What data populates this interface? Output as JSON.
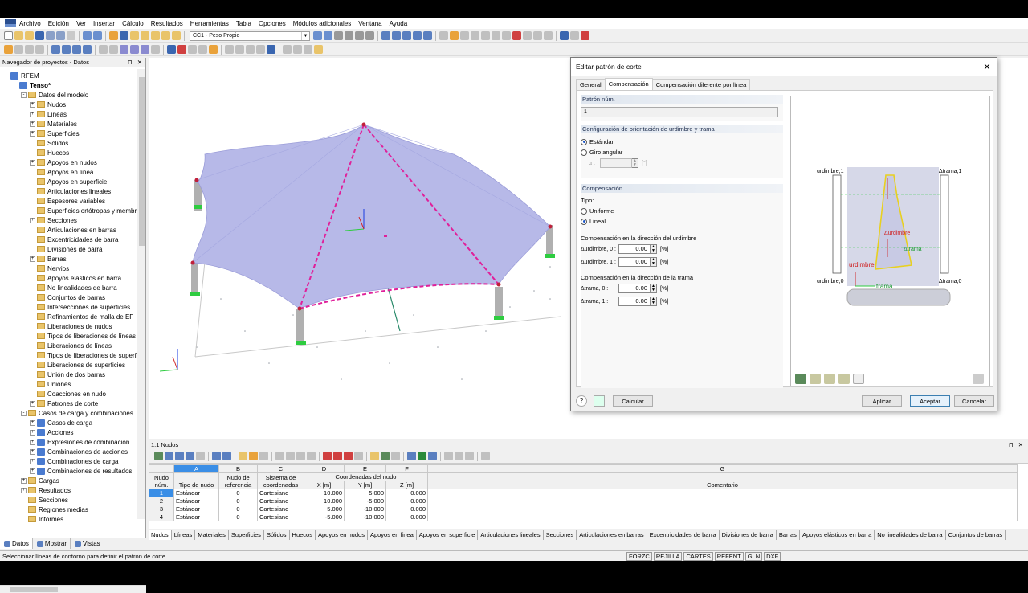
{
  "menu": [
    "Archivo",
    "Edición",
    "Ver",
    "Insertar",
    "Cálculo",
    "Resultados",
    "Herramientas",
    "Tabla",
    "Opciones",
    "Módulos adicionales",
    "Ventana",
    "Ayuda"
  ],
  "toolbar": {
    "loadcase": "CC1 - Peso Propio"
  },
  "navigator": {
    "title": "Navegador de proyectos - Datos",
    "items": [
      {
        "label": "RFEM",
        "level": 0,
        "kind": "root"
      },
      {
        "label": "Tenso*",
        "level": 1,
        "kind": "project"
      },
      {
        "label": "Datos del modelo",
        "level": 2,
        "kind": "folder",
        "exp": "-"
      },
      {
        "label": "Nudos",
        "level": 3,
        "kind": "folder",
        "exp": "+"
      },
      {
        "label": "Líneas",
        "level": 3,
        "kind": "folder",
        "exp": "+"
      },
      {
        "label": "Materiales",
        "level": 3,
        "kind": "folder",
        "exp": "+"
      },
      {
        "label": "Superficies",
        "level": 3,
        "kind": "folder",
        "exp": "+"
      },
      {
        "label": "Sólidos",
        "level": 3,
        "kind": "folder"
      },
      {
        "label": "Huecos",
        "level": 3,
        "kind": "folder"
      },
      {
        "label": "Apoyos en nudos",
        "level": 3,
        "kind": "folder",
        "exp": "+"
      },
      {
        "label": "Apoyos en línea",
        "level": 3,
        "kind": "folder"
      },
      {
        "label": "Apoyos en superficie",
        "level": 3,
        "kind": "folder"
      },
      {
        "label": "Articulaciones lineales",
        "level": 3,
        "kind": "folder"
      },
      {
        "label": "Espesores variables",
        "level": 3,
        "kind": "folder"
      },
      {
        "label": "Superficies ortótropas y membr",
        "level": 3,
        "kind": "folder"
      },
      {
        "label": "Secciones",
        "level": 3,
        "kind": "folder",
        "exp": "+"
      },
      {
        "label": "Articulaciones en barras",
        "level": 3,
        "kind": "folder"
      },
      {
        "label": "Excentricidades de barra",
        "level": 3,
        "kind": "folder"
      },
      {
        "label": "Divisiones de barra",
        "level": 3,
        "kind": "folder"
      },
      {
        "label": "Barras",
        "level": 3,
        "kind": "folder",
        "exp": "+"
      },
      {
        "label": "Nervios",
        "level": 3,
        "kind": "folder"
      },
      {
        "label": "Apoyos elásticos en barra",
        "level": 3,
        "kind": "folder"
      },
      {
        "label": "No linealidades de barra",
        "level": 3,
        "kind": "folder"
      },
      {
        "label": "Conjuntos de barras",
        "level": 3,
        "kind": "folder"
      },
      {
        "label": "Intersecciones de superficies",
        "level": 3,
        "kind": "folder"
      },
      {
        "label": "Refinamientos de malla de EF",
        "level": 3,
        "kind": "folder"
      },
      {
        "label": "Liberaciones de nudos",
        "level": 3,
        "kind": "folder"
      },
      {
        "label": "Tipos de liberaciones de líneas",
        "level": 3,
        "kind": "folder"
      },
      {
        "label": "Liberaciones de líneas",
        "level": 3,
        "kind": "folder"
      },
      {
        "label": "Tipos de liberaciones de superfi",
        "level": 3,
        "kind": "folder"
      },
      {
        "label": "Liberaciones de superficies",
        "level": 3,
        "kind": "folder"
      },
      {
        "label": "Unión de dos barras",
        "level": 3,
        "kind": "folder"
      },
      {
        "label": "Uniones",
        "level": 3,
        "kind": "folder"
      },
      {
        "label": "Coacciones en nudo",
        "level": 3,
        "kind": "folder"
      },
      {
        "label": "Patrones de corte",
        "level": 3,
        "kind": "folder",
        "exp": "+"
      },
      {
        "label": "Casos de carga y combinaciones",
        "level": 2,
        "kind": "folder",
        "exp": "-"
      },
      {
        "label": "Casos de carga",
        "level": 3,
        "kind": "lc",
        "exp": "+"
      },
      {
        "label": "Acciones",
        "level": 3,
        "kind": "lc",
        "exp": "+"
      },
      {
        "label": "Expresiones de combinación",
        "level": 3,
        "kind": "lc",
        "exp": "+"
      },
      {
        "label": "Combinaciones de acciones",
        "level": 3,
        "kind": "lc",
        "exp": "+"
      },
      {
        "label": "Combinaciones de carga",
        "level": 3,
        "kind": "lc",
        "exp": "+"
      },
      {
        "label": "Combinaciones de resultados",
        "level": 3,
        "kind": "lc",
        "exp": "+"
      },
      {
        "label": "Cargas",
        "level": 2,
        "kind": "folder",
        "exp": "+"
      },
      {
        "label": "Resultados",
        "level": 2,
        "kind": "folder",
        "exp": "+"
      },
      {
        "label": "Secciones",
        "level": 2,
        "kind": "folder"
      },
      {
        "label": "Regiones medias",
        "level": 2,
        "kind": "folder"
      },
      {
        "label": "Informes",
        "level": 2,
        "kind": "folder"
      }
    ],
    "tabs": [
      "Datos",
      "Mostrar",
      "Vistas"
    ]
  },
  "dialog": {
    "title": "Editar patrón de corte",
    "tabs": [
      "General",
      "Compensación",
      "Compensación diferente por línea"
    ],
    "patron_label": "Patrón núm.",
    "patron_value": "1",
    "config_header": "Configuración de orientación de urdimbre y trama",
    "opt_estandar": "Estándar",
    "opt_giro": "Giro angular",
    "alpha_label": "α :",
    "alpha_unit": "[°]",
    "comp_header": "Compensación",
    "tipo_label": "Tipo:",
    "opt_uniforme": "Uniforme",
    "opt_lineal": "Lineal",
    "urd_title": "Compensación en la dirección del urdimbre",
    "trama_title": "Compensación en la dirección de la trama",
    "fields": [
      {
        "label": "Δurdimbre, 0 :",
        "value": "0.00",
        "unit": "[%]"
      },
      {
        "label": "Δurdimbre, 1 :",
        "value": "0.00",
        "unit": "[%]"
      },
      {
        "label": "Δtrama, 0 :",
        "value": "0.00",
        "unit": "[%]"
      },
      {
        "label": "Δtrama, 1 :",
        "value": "0.00",
        "unit": "[%]"
      }
    ],
    "preview": {
      "urd1": "urdimbre,1",
      "urd0": "urdimbre,0",
      "trama1": "Δtrama,1",
      "trama0": "Δtrama,0",
      "dUrd": "Δurdimbre",
      "dTrama": "Δtrama",
      "urdimbre": "urdimbre",
      "trama": "trama"
    },
    "btn_calcular": "Calcular",
    "btn_aplicar": "Aplicar",
    "btn_aceptar": "Aceptar",
    "btn_cancelar": "Cancelar"
  },
  "table": {
    "title": "1.1 Nudos",
    "col_letters": [
      "A",
      "B",
      "C",
      "D",
      "E",
      "F",
      "G"
    ],
    "headers": {
      "nudo": "Nudo",
      "num": "núm.",
      "tipo": "Tipo de nudo",
      "ref1": "Nudo de",
      "ref2": "referencia",
      "sis1": "Sistema de",
      "sis2": "coordenadas",
      "coord": "Coordenadas del nudo",
      "x": "X [m]",
      "y": "Y [m]",
      "z": "Z [m]",
      "com": "Comentario"
    },
    "rows": [
      [
        "1",
        "Estándar",
        "0",
        "Cartesiano",
        "10.000",
        "5.000",
        "0.000"
      ],
      [
        "2",
        "Estándar",
        "0",
        "Cartesiano",
        "10.000",
        "-5.000",
        "0.000"
      ],
      [
        "3",
        "Estándar",
        "0",
        "Cartesiano",
        "5.000",
        "-10.000",
        "0.000"
      ],
      [
        "4",
        "Estándar",
        "0",
        "Cartesiano",
        "-5.000",
        "-10.000",
        "0.000"
      ]
    ],
    "tabs": [
      "Nudos",
      "Líneas",
      "Materiales",
      "Superficies",
      "Sólidos",
      "Huecos",
      "Apoyos en nudos",
      "Apoyos en línea",
      "Apoyos en superficie",
      "Articulaciones lineales",
      "Secciones",
      "Articulaciones en barras",
      "Excentricidades de barra",
      "Divisiones de barra",
      "Barras",
      "Apoyos elásticos en barra",
      "No linealidades de barra",
      "Conjuntos de barras"
    ]
  },
  "status": {
    "message": "Seleccionar líneas de contorno para definir el patrón de corte.",
    "buttons": [
      "FORZC",
      "REJILLA",
      "CARTES",
      "REFENT",
      "GLN",
      "DXF"
    ]
  },
  "colors": {
    "membrane": "#b7b9e8",
    "cutline": "#e0209a",
    "support": "#2ecc40",
    "column": "#b0b0b0",
    "selection": "#3a8ee6"
  }
}
